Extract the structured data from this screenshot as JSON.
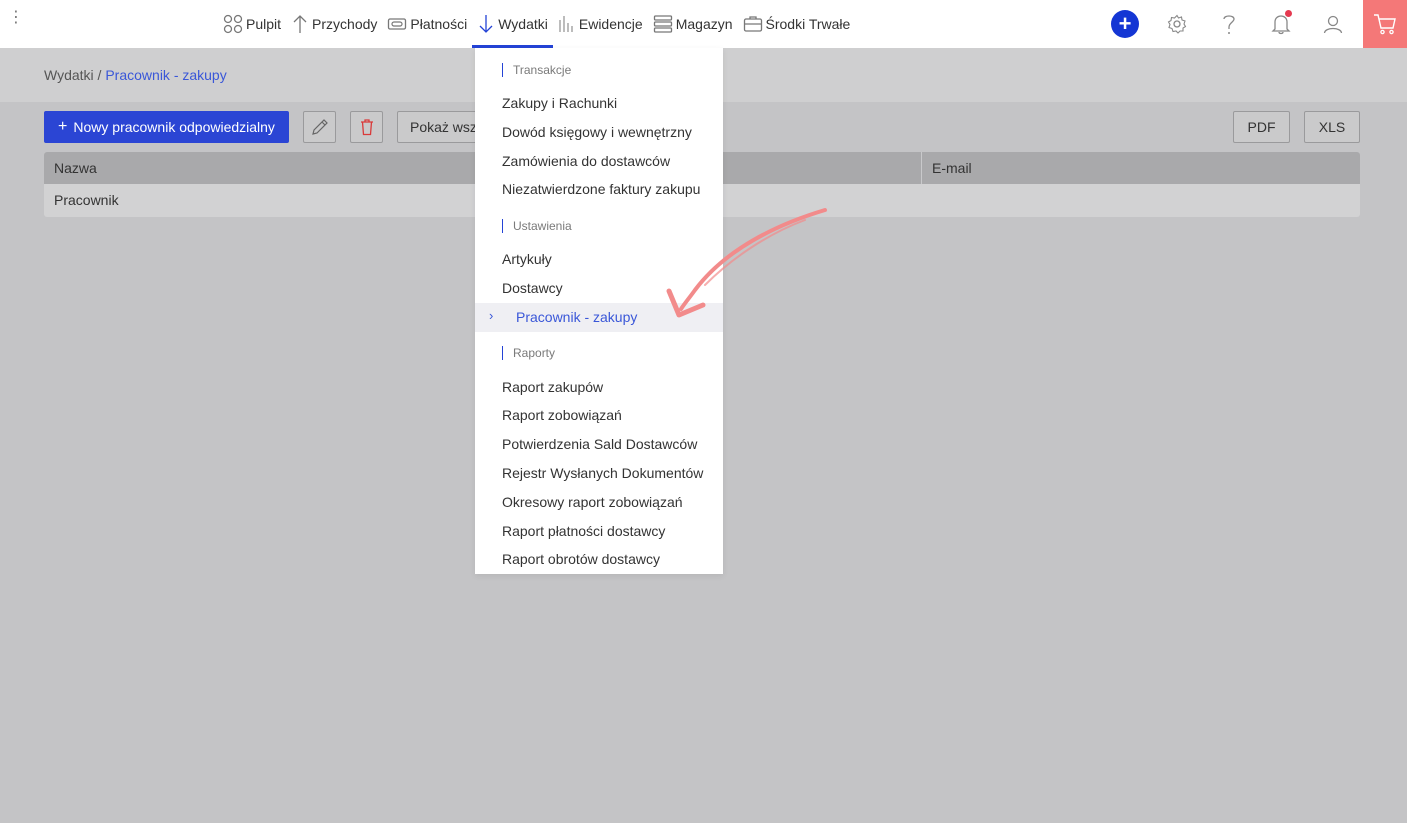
{
  "nav": {
    "items": [
      {
        "label": "Pulpit",
        "icon": "dashboard-icon"
      },
      {
        "label": "Przychody",
        "icon": "arrow-up-icon"
      },
      {
        "label": "Płatności",
        "icon": "money-icon"
      },
      {
        "label": "Wydatki",
        "icon": "arrow-down-icon",
        "active": true
      },
      {
        "label": "Ewidencje",
        "icon": "bar-chart-icon"
      },
      {
        "label": "Magazyn",
        "icon": "stack-icon"
      },
      {
        "label": "Środki Trwałe",
        "icon": "briefcase-icon"
      }
    ]
  },
  "breadcrumb": {
    "parent": "Wydatki",
    "separator": " / ",
    "current": "Pracownik - zakupy"
  },
  "toolbar": {
    "new_button": "Nowy pracownik odpowiedzialny",
    "show_all": "Pokaż wszystkie",
    "pdf": "PDF",
    "xls": "XLS"
  },
  "table": {
    "columns": [
      "Nazwa",
      "E-mail"
    ],
    "rows": [
      [
        "Pracownik",
        ""
      ]
    ]
  },
  "dropdown": {
    "sections": [
      {
        "title": "Transakcje",
        "items": [
          "Zakupy i Rachunki",
          "Dowód księgowy i wewnętrzny",
          "Zamówienia do dostawców",
          "Niezatwierdzone faktury zakupu"
        ]
      },
      {
        "title": "Ustawienia",
        "items": [
          "Artykuły",
          "Dostawcy",
          "Pracownik - zakupy"
        ]
      },
      {
        "title": "Raporty",
        "items": [
          "Raport zakupów",
          "Raport zobowiązań",
          "Potwierdzenia Sald Dostawców",
          "Rejestr Wysłanych Dokumentów",
          "Okresowy raport zobowiązań",
          "Raport płatności dostawcy",
          "Raport obrotów dostawcy"
        ]
      }
    ],
    "active_item": "Pracownik - zakupy"
  },
  "colors": {
    "accent": "#2443d6",
    "cart": "#f47878",
    "annotation_arrow": "#f28b8b",
    "overlay": "#c4c4c6"
  }
}
